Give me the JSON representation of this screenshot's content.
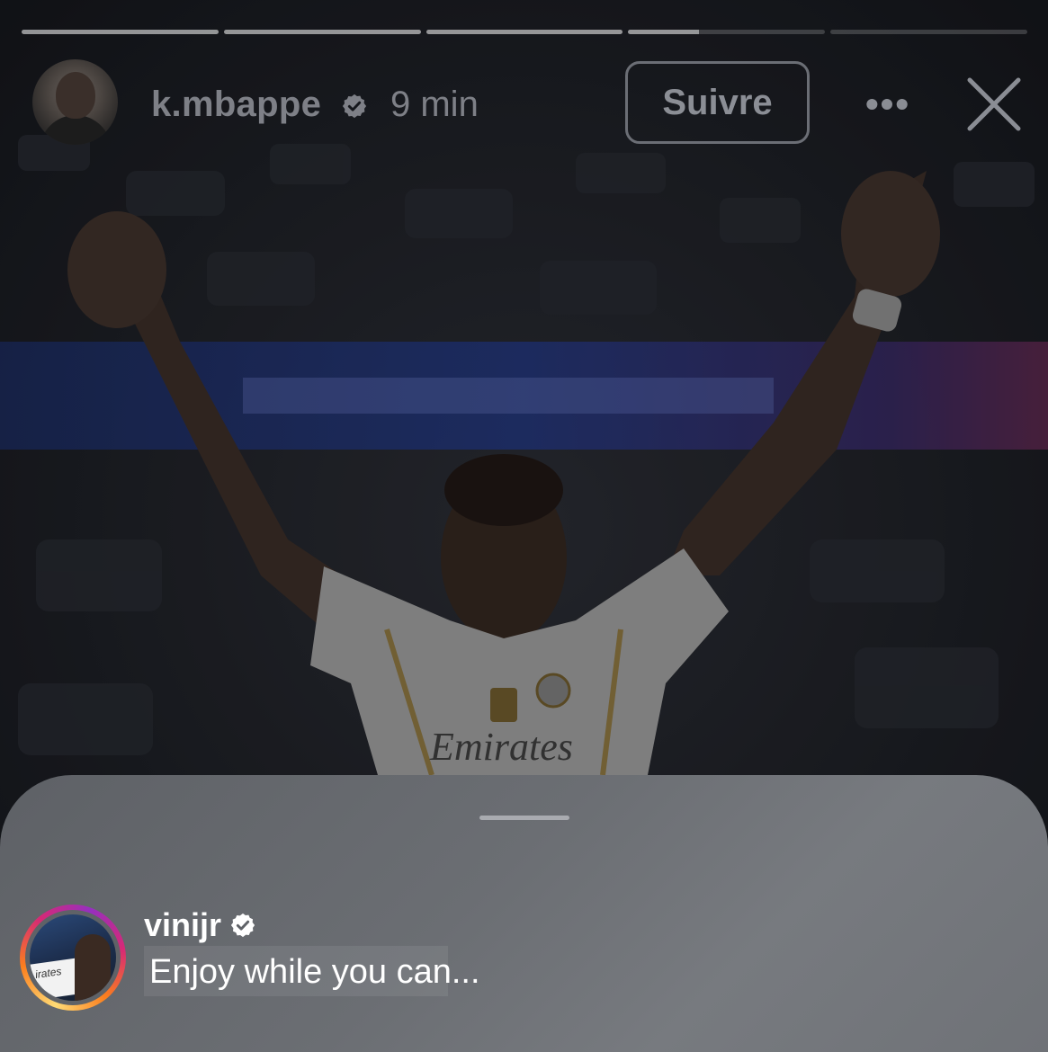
{
  "story": {
    "progress": [
      1,
      1,
      1,
      0.36,
      0
    ],
    "author": {
      "username": "k.mbappe",
      "verified_icon": "verified-badge-icon",
      "time_ago": "9 min"
    },
    "follow_label": "Suivre",
    "more_label": "•••",
    "close_icon": "close-icon"
  },
  "reply": {
    "username": "vinijr",
    "verified_icon": "verified-badge-icon",
    "message": "Enjoy while you can...",
    "avatar_jersey_text": "irates"
  },
  "colors": {
    "ring_gradient": [
      "#feda75",
      "#fa7e1e",
      "#d62976",
      "#962fbf"
    ],
    "sheet": "#6b6e73",
    "banner_blue": "#1f3a8a"
  }
}
